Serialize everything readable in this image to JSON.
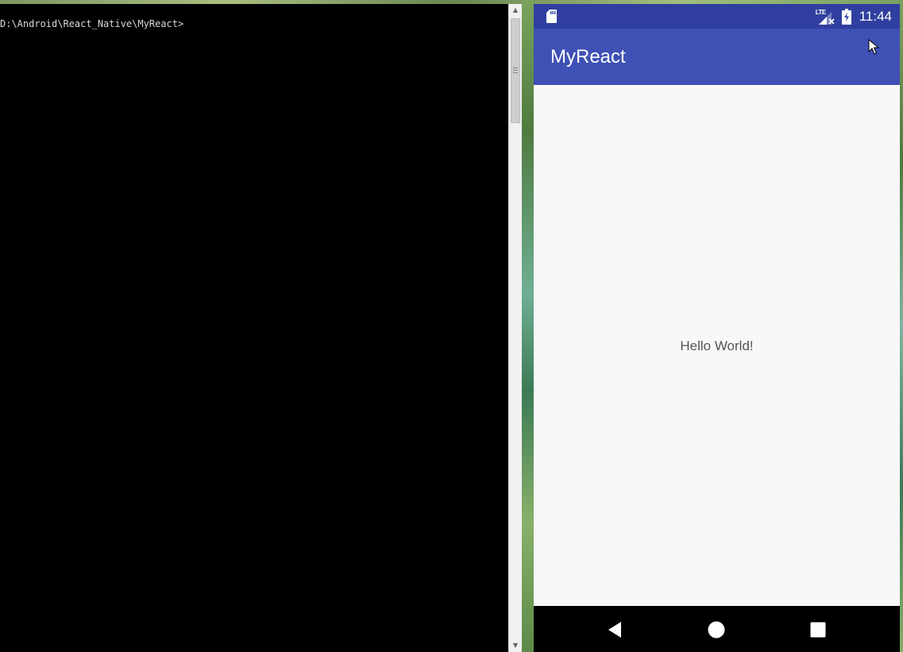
{
  "console": {
    "prompt": "D:\\Android\\React_Native\\MyReact>"
  },
  "phone": {
    "status_bar": {
      "time": "11:44",
      "network_label": "LTE",
      "icons": [
        "sd-card-icon",
        "signal-icon",
        "battery-charging-icon"
      ],
      "color": "#303f9f"
    },
    "app_bar": {
      "title": "MyReact",
      "color": "#3f51b5"
    },
    "content": {
      "text": "Hello World!"
    },
    "nav_bar": {
      "icons": [
        "back-icon",
        "home-icon",
        "recents-icon"
      ]
    }
  }
}
